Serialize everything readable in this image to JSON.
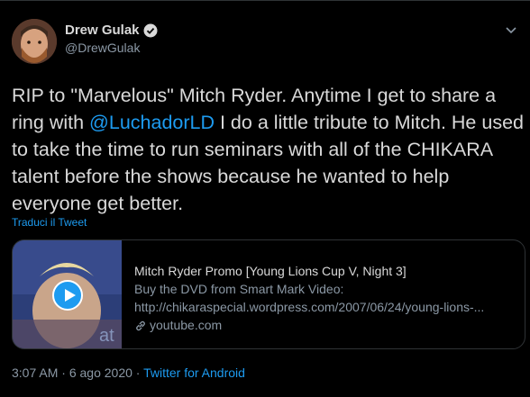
{
  "author": {
    "name": "Drew Gulak",
    "handle": "@DrewGulak"
  },
  "tweet": {
    "text_before": "RIP to \"Marvelous\" Mitch Ryder. Anytime I get to share a ring with ",
    "mention": "@LuchadorLD",
    "text_after": " I do a little tribute to Mitch. He used to take the time to run seminars with all of the CHIKARA talent before the shows because he wanted to help everyone get better."
  },
  "translate_label": "Traduci il Tweet",
  "card": {
    "title": "Mitch Ryder Promo [Young Lions Cup V, Night 3]",
    "desc_line1": "Buy the DVD from Smart Mark Video:",
    "desc_line2": "http://chikaraspecial.wordpress.com/2007/06/24/young-lions-...",
    "domain": "youtube.com"
  },
  "meta": {
    "time": "3:07 AM",
    "separator1": " · ",
    "date": "6 ago 2020",
    "separator2": " · ",
    "source": "Twitter for Android"
  },
  "colors": {
    "background": "#000000",
    "accent": "#1d9bf0",
    "secondary_text": "#8b98a5"
  }
}
